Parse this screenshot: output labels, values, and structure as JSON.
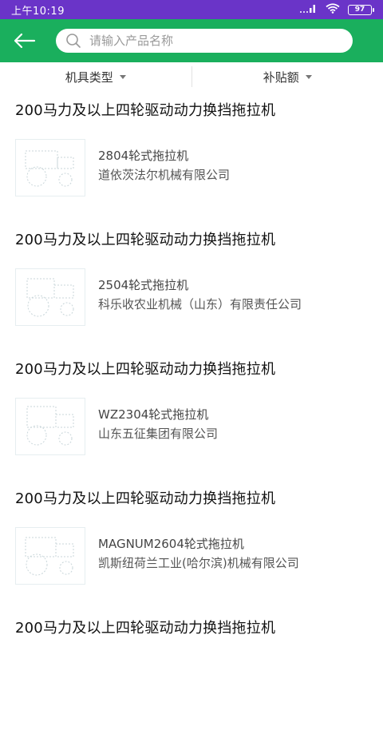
{
  "status_bar": {
    "time": "上午10:19",
    "signal": "...ll",
    "battery": "97"
  },
  "header": {
    "back_icon": "back-arrow-icon",
    "search_icon": "search-icon",
    "search_placeholder": "请输入产品名称",
    "search_value": ""
  },
  "filters": [
    {
      "label": "机具类型"
    },
    {
      "label": "补贴额"
    }
  ],
  "colors": {
    "status_bar": "#6a34c8",
    "header": "#1aaf5d"
  },
  "groups": [
    {
      "category": "200马力及以上四轮驱动动力换挡拖拉机",
      "product": "2804轮式拖拉机",
      "company": "道依茨法尔机械有限公司"
    },
    {
      "category": "200马力及以上四轮驱动动力换挡拖拉机",
      "product": "2504轮式拖拉机",
      "company": "科乐收农业机械（山东）有限责任公司"
    },
    {
      "category": "200马力及以上四轮驱动动力换挡拖拉机",
      "product": "WZ2304轮式拖拉机",
      "company": "山东五征集团有限公司"
    },
    {
      "category": "200马力及以上四轮驱动动力换挡拖拉机",
      "product": "MAGNUM2604轮式拖拉机",
      "company": "凯斯纽荷兰工业(哈尔滨)机械有限公司"
    },
    {
      "category": "200马力及以上四轮驱动动力换挡拖拉机"
    }
  ]
}
